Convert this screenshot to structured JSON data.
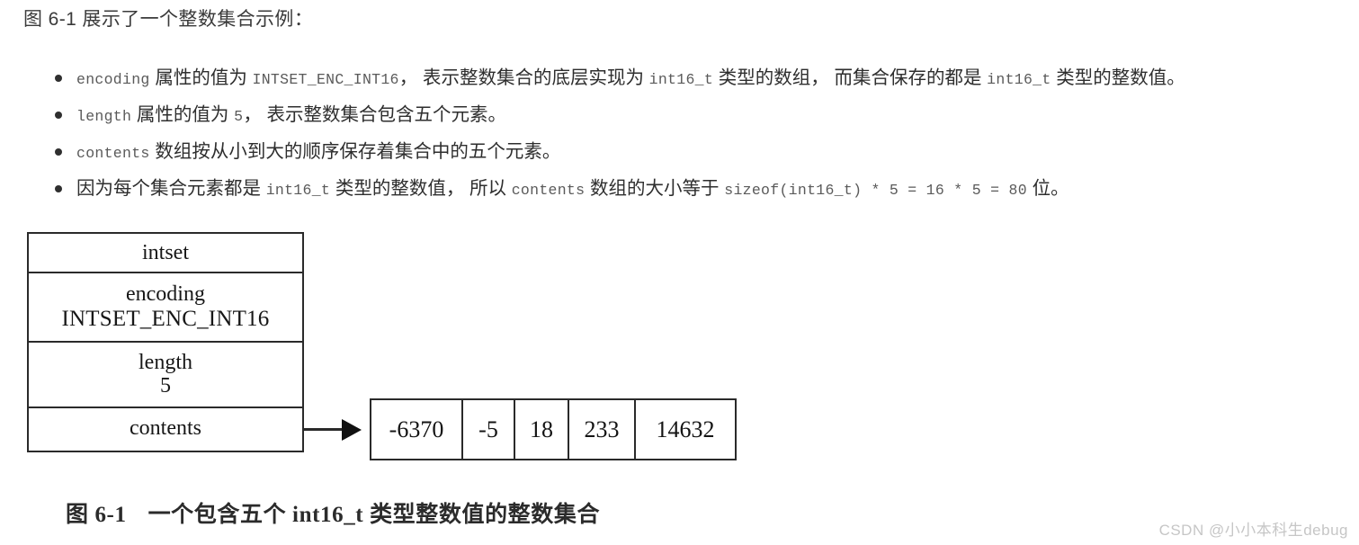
{
  "intro": "图 6-1 展示了一个整数集合示例：",
  "bullets": [
    {
      "id": "bullet-encoding",
      "parts": [
        {
          "t": "code",
          "v": "encoding"
        },
        {
          "t": "cjk",
          "v": " 属性的值为 "
        },
        {
          "t": "code",
          "v": "INTSET_ENC_INT16"
        },
        {
          "t": "cjk",
          "v": "，  表示整数集合的底层实现为 "
        },
        {
          "t": "code",
          "v": "int16_t"
        },
        {
          "t": "cjk",
          "v": " 类型的数组，  而集合保存的都是 "
        },
        {
          "t": "code",
          "v": "int16_t"
        },
        {
          "t": "cjk",
          "v": " 类型的整数值。"
        }
      ]
    },
    {
      "id": "bullet-length",
      "parts": [
        {
          "t": "code",
          "v": "length"
        },
        {
          "t": "cjk",
          "v": " 属性的值为 "
        },
        {
          "t": "code",
          "v": "5"
        },
        {
          "t": "cjk",
          "v": "，  表示整数集合包含五个元素。"
        }
      ]
    },
    {
      "id": "bullet-contents",
      "parts": [
        {
          "t": "code",
          "v": "contents"
        },
        {
          "t": "cjk",
          "v": " 数组按从小到大的顺序保存着集合中的五个元素。"
        }
      ]
    },
    {
      "id": "bullet-size",
      "parts": [
        {
          "t": "cjk",
          "v": "因为每个集合元素都是 "
        },
        {
          "t": "code",
          "v": "int16_t"
        },
        {
          "t": "cjk",
          "v": " 类型的整数值，  所以 "
        },
        {
          "t": "code",
          "v": "contents"
        },
        {
          "t": "cjk",
          "v": " 数组的大小等于 "
        },
        {
          "t": "code",
          "v": "sizeof(int16_t) * 5 = 16 * 5 = 80"
        },
        {
          "t": "cjk",
          "v": " 位。"
        }
      ]
    }
  ],
  "diagram": {
    "struct": {
      "title": "intset",
      "rows": [
        {
          "name": "encoding",
          "value": "INTSET_ENC_INT16"
        },
        {
          "name": "length",
          "value": "5"
        },
        {
          "name": "contents",
          "value": ""
        }
      ]
    },
    "array": {
      "cells": [
        "-6370",
        "-5",
        "18",
        "233",
        "14632"
      ]
    },
    "pointer_icon": "arrow-right-icon"
  },
  "caption": {
    "label": "图 6-1",
    "text": "一个包含五个 int16_t 类型整数值的整数集合"
  },
  "watermark": "CSDN @小小本科生debug",
  "colors": {
    "ink": "#2e2e2e",
    "code": "#5a5a5a",
    "stroke": "#2a2a2a",
    "watermark": "#c6c6c6"
  }
}
